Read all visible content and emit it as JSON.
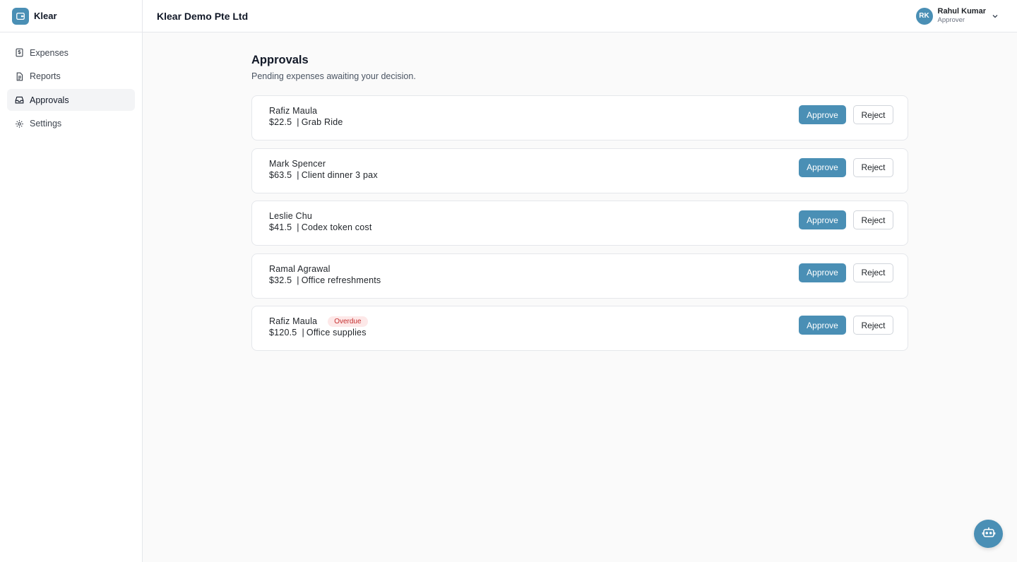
{
  "brand": {
    "name": "Klear",
    "icon": "wallet-icon"
  },
  "colors": {
    "accent": "#4a8fb5",
    "overdue_bg": "#fde8e8",
    "overdue_text": "#c53030"
  },
  "sidebar": {
    "items": [
      {
        "label": "Expenses",
        "icon": "dollar-receipt-icon",
        "active": false
      },
      {
        "label": "Reports",
        "icon": "document-icon",
        "active": false
      },
      {
        "label": "Approvals",
        "icon": "inbox-icon",
        "active": true
      },
      {
        "label": "Settings",
        "icon": "gear-icon",
        "active": false
      }
    ]
  },
  "header": {
    "org_name": "Klear Demo Pte Ltd",
    "user": {
      "initials": "RK",
      "name": "Rahul Kumar",
      "role": "Approver"
    }
  },
  "main": {
    "title": "Approvals",
    "subtitle": "Pending expenses awaiting your decision.",
    "approve_label": "Approve",
    "reject_label": "Reject",
    "approvals": [
      {
        "name": "Rafiz Maula",
        "amount": "$22.5",
        "description": "Grab Ride",
        "badge": ""
      },
      {
        "name": "Mark Spencer",
        "amount": "$63.5",
        "description": "Client dinner 3 pax",
        "badge": ""
      },
      {
        "name": "Leslie Chu",
        "amount": "$41.5",
        "description": "Codex token cost",
        "badge": ""
      },
      {
        "name": "Ramal Agrawal",
        "amount": "$32.5",
        "description": "Office refreshments",
        "badge": ""
      },
      {
        "name": "Rafiz Maula",
        "amount": "$120.5",
        "description": "Office supplies",
        "badge": "Overdue"
      }
    ]
  },
  "assistant": {
    "icon": "robot-icon"
  }
}
